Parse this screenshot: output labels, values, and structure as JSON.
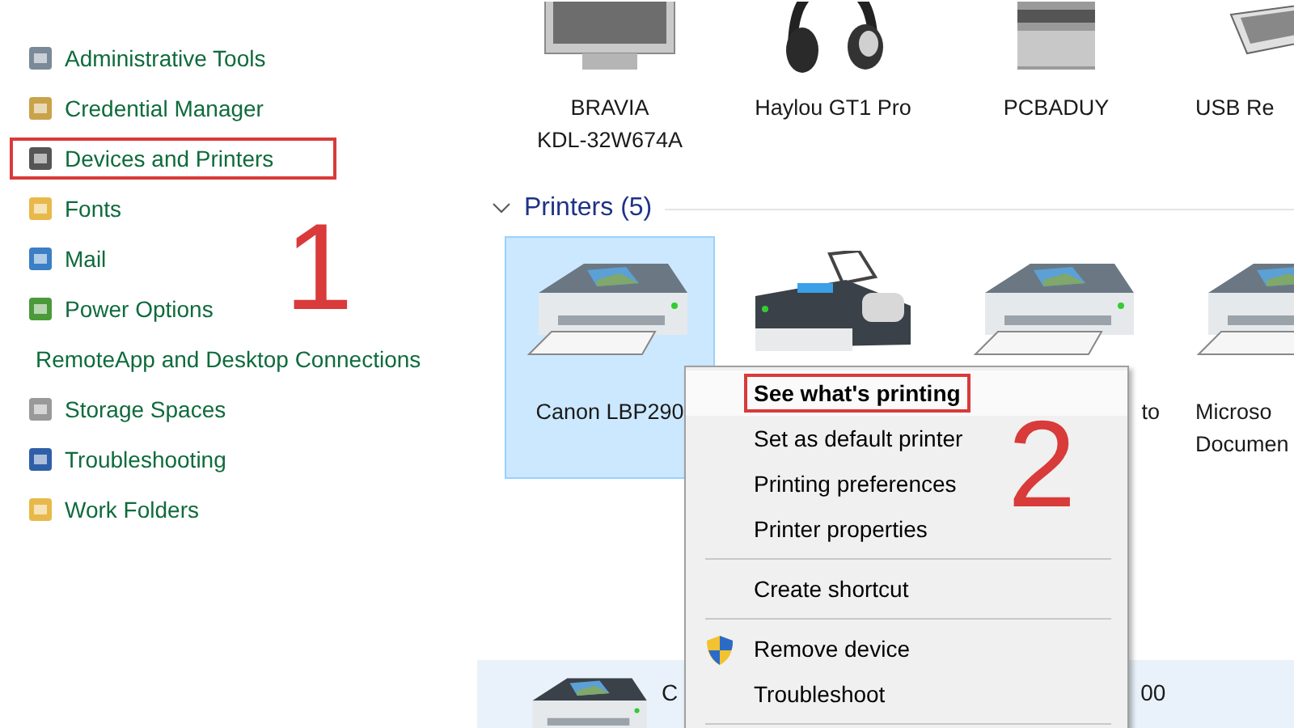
{
  "sidebar": {
    "items": [
      {
        "label": "Administrative Tools",
        "annotated": false
      },
      {
        "label": "Credential Manager",
        "annotated": false
      },
      {
        "label": "Devices and Printers",
        "annotated": true
      },
      {
        "label": "Fonts",
        "annotated": false
      },
      {
        "label": "Mail",
        "annotated": false
      },
      {
        "label": "Power Options",
        "annotated": false
      },
      {
        "label": "RemoteApp and Desktop Connections",
        "annotated": false
      },
      {
        "label": "Storage Spaces",
        "annotated": false
      },
      {
        "label": "Troubleshooting",
        "annotated": false
      },
      {
        "label": "Work Folders",
        "annotated": false
      }
    ]
  },
  "devices": [
    {
      "kind": "tv",
      "lines": [
        "BRAVIA",
        "KDL-32W674A"
      ]
    },
    {
      "kind": "headset",
      "lines": [
        "Haylou GT1 Pro"
      ]
    },
    {
      "kind": "computer",
      "lines": [
        "PCBADUY"
      ]
    },
    {
      "kind": "keyboard",
      "lines": [
        "USB Re"
      ]
    }
  ],
  "printers": {
    "title": "Printers (5)",
    "expanded": true,
    "items": [
      {
        "kind": "printer",
        "selected": true,
        "lines": [
          "Canon LBP290"
        ]
      },
      {
        "kind": "fax",
        "selected": false
      },
      {
        "kind": "printer",
        "selected": false,
        "lines": [
          "to"
        ]
      },
      {
        "kind": "printer",
        "selected": false,
        "lines": [
          "Microso",
          "Documen"
        ]
      }
    ]
  },
  "details": {
    "texts": [
      "C",
      "00"
    ]
  },
  "context_menu": {
    "items": [
      {
        "kind": "item",
        "label": "See what's printing",
        "default": true,
        "annotated": true
      },
      {
        "kind": "item",
        "label": "Set as default printer",
        "default": false,
        "annotated": false
      },
      {
        "kind": "item",
        "label": "Printing preferences",
        "default": false,
        "annotated": false
      },
      {
        "kind": "item",
        "label": "Printer properties",
        "default": false,
        "annotated": false
      },
      {
        "kind": "separator"
      },
      {
        "kind": "item",
        "label": "Create shortcut",
        "default": false,
        "annotated": false
      },
      {
        "kind": "separator"
      },
      {
        "kind": "shield",
        "label": "Remove device",
        "default": false,
        "annotated": false
      },
      {
        "kind": "item",
        "label": "Troubleshoot",
        "default": false,
        "annotated": false
      },
      {
        "kind": "separator"
      }
    ]
  },
  "annotations": [
    "1",
    "2"
  ]
}
